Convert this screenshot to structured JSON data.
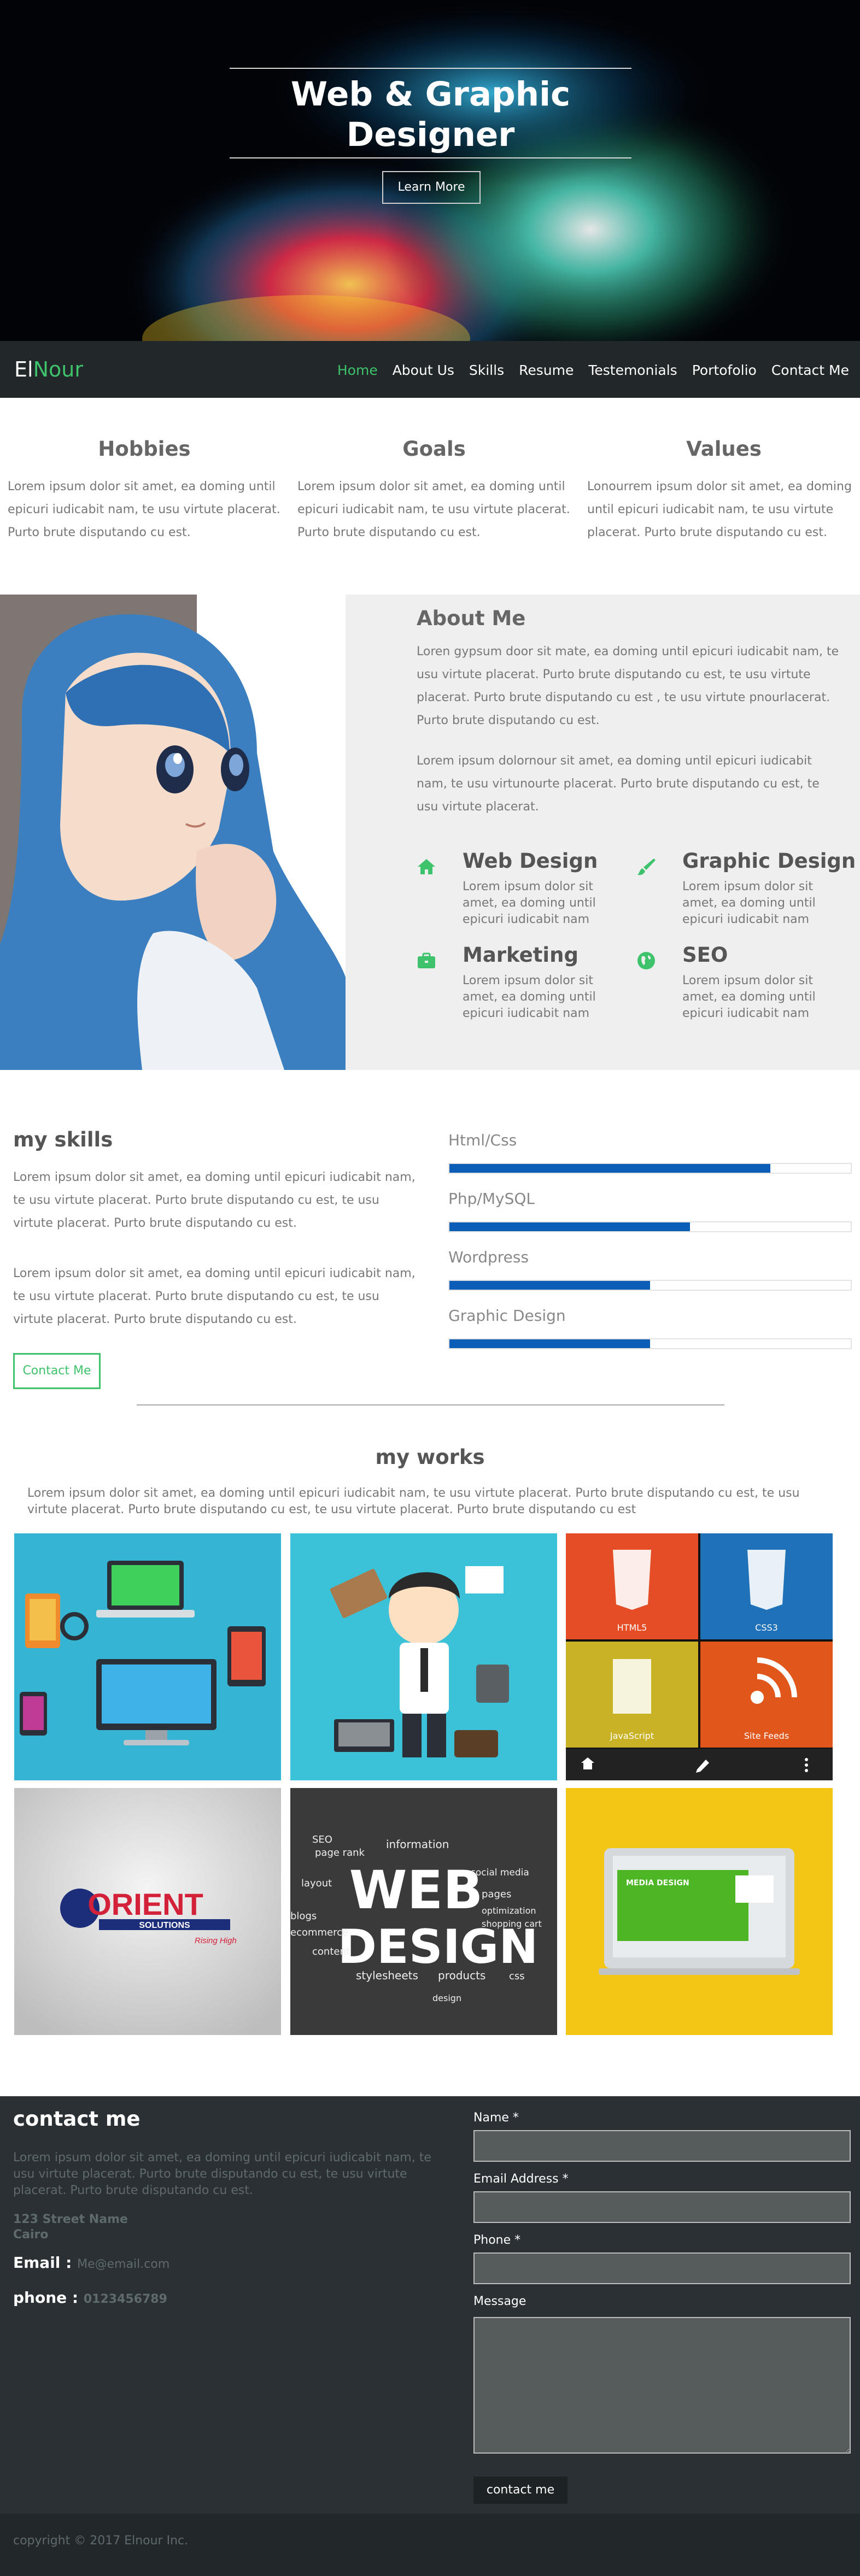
{
  "hero": {
    "title_line1": "Web & Graphic",
    "title_line2": "Designer",
    "button_label": "Learn More"
  },
  "nav": {
    "logo_part1": "El",
    "logo_part2": "Nour",
    "items": [
      "Home",
      "About Us",
      "Skills",
      "Resume",
      "Testemonials",
      "Portofolio",
      "Contact Me"
    ],
    "active_color": "#3ec26b"
  },
  "features": [
    {
      "title": "Hobbies",
      "text": "Lorem ipsum dolor sit amet, ea doming until epicuri iudicabit nam, te usu virtute placerat. Purto brute disputando cu est."
    },
    {
      "title": "Goals",
      "text": "Lorem ipsum dolor sit amet, ea doming until epicuri iudicabit nam, te usu virtute placerat. Purto brute disputando cu est."
    },
    {
      "title": "Values",
      "text": "Lonourrem ipsum dolor sit amet, ea doming until epicuri iudicabit nam, te usu virtute placerat. Purto brute disputando cu est."
    }
  ],
  "about": {
    "title": "About Me",
    "p1": "Loren gypsum door sit mate, ea doming until epicuri iudicabit nam, te usu virtute placerat. Purto brute disputando cu est, te usu virtute placerat. Purto brute disputando cu est , te usu virtute pnourlacerat. Purto brute disputando cu est.",
    "p2": "Lorem ipsum dolornour sit amet, ea doming until epicuri iudicabit nam, te usu virtunourte placerat. Purto brute disputando cu est, te usu virtute placerat.",
    "services": [
      {
        "icon": "home-icon",
        "title": "Web Design",
        "text": "Lorem ipsum dolor sit amet, ea doming until epicuri iudicabit nam"
      },
      {
        "icon": "brush-icon",
        "title": "Graphic Design",
        "text": "Lorem ipsum dolor sit amet, ea doming until epicuri iudicabit nam"
      },
      {
        "icon": "briefcase-icon",
        "title": "Marketing",
        "text": "Lorem ipsum dolor sit amet, ea doming until epicuri iudicabit nam"
      },
      {
        "icon": "globe-icon",
        "title": "SEO",
        "text": "Lorem ipsum dolor sit amet, ea doming until epicuri iudicabit nam"
      }
    ]
  },
  "skills": {
    "title": "my skills",
    "p1": "Lorem ipsum dolor sit amet, ea doming until epicuri iudicabit nam, te usu virtute placerat. Purto brute disputando cu est, te usu virtute placerat. Purto brute disputando cu est.",
    "p2": "Lorem ipsum dolor sit amet, ea doming until epicuri iudicabit nam, te usu virtute placerat. Purto brute disputando cu est, te usu virtute placerat. Purto brute disputando cu est.",
    "button_label": "Contact Me",
    "bars": [
      {
        "label": "Html/Css",
        "percent": 80
      },
      {
        "label": "Php/MySQL",
        "percent": 60
      },
      {
        "label": "Wordpress",
        "percent": 50
      },
      {
        "label": "Graphic Design",
        "percent": 50
      }
    ],
    "bar_color": "#0b5db5"
  },
  "works": {
    "title": "my works",
    "text": "Lorem ipsum dolor sit amet, ea doming until epicuri iudicabit nam, te usu virtute placerat. Purto brute disputando cu est, te usu virtute placerat. Purto brute disputando cu est, te usu virtute placerat. Purto brute disputando cu est",
    "tiles": [
      "responsive-devices-illustration",
      "busy-designer-illustration",
      "html5-css3-javascript-tiles",
      "orient-solutions-logo",
      "web-design-word-cloud",
      "media-design-laptop"
    ],
    "tile_texts": {
      "html5": "HTML5",
      "css3": "CSS3",
      "js": "JavaScript",
      "feeds": "Site Feeds",
      "orient": "ORIENT",
      "solutions": "SOLUTIONS",
      "rising": "Rising High",
      "web": "WEB",
      "design": "DESIGN",
      "media": "MEDIA DESIGN",
      "words": [
        "SEO",
        "page rank",
        "layout",
        "information",
        "social media",
        "pages",
        "optimization",
        "shopping cart",
        "blogs",
        "ecommerce",
        "content",
        "stylesheets",
        "products",
        "css",
        "design"
      ]
    }
  },
  "contact": {
    "title": "contact me",
    "text": "Lorem ipsum dolor sit amet, ea doming until epicuri iudicabit nam, te usu virtute placerat. Purto brute disputando cu est, te usu virtute placerat. Purto brute disputando cu est.",
    "address_line1": "123 Street Name",
    "address_line2": "Cairo",
    "email_label": "Email :",
    "email_value": "Me@email.com",
    "phone_label": "phone :",
    "phone_value": "0123456789",
    "form": {
      "name_label": "Name *",
      "email_label": "Email Address *",
      "phone_label": "Phone *",
      "message_label": "Message",
      "submit_label": "contact me"
    }
  },
  "footer": {
    "copyright": "copyright © 2017 Elnour Inc."
  }
}
